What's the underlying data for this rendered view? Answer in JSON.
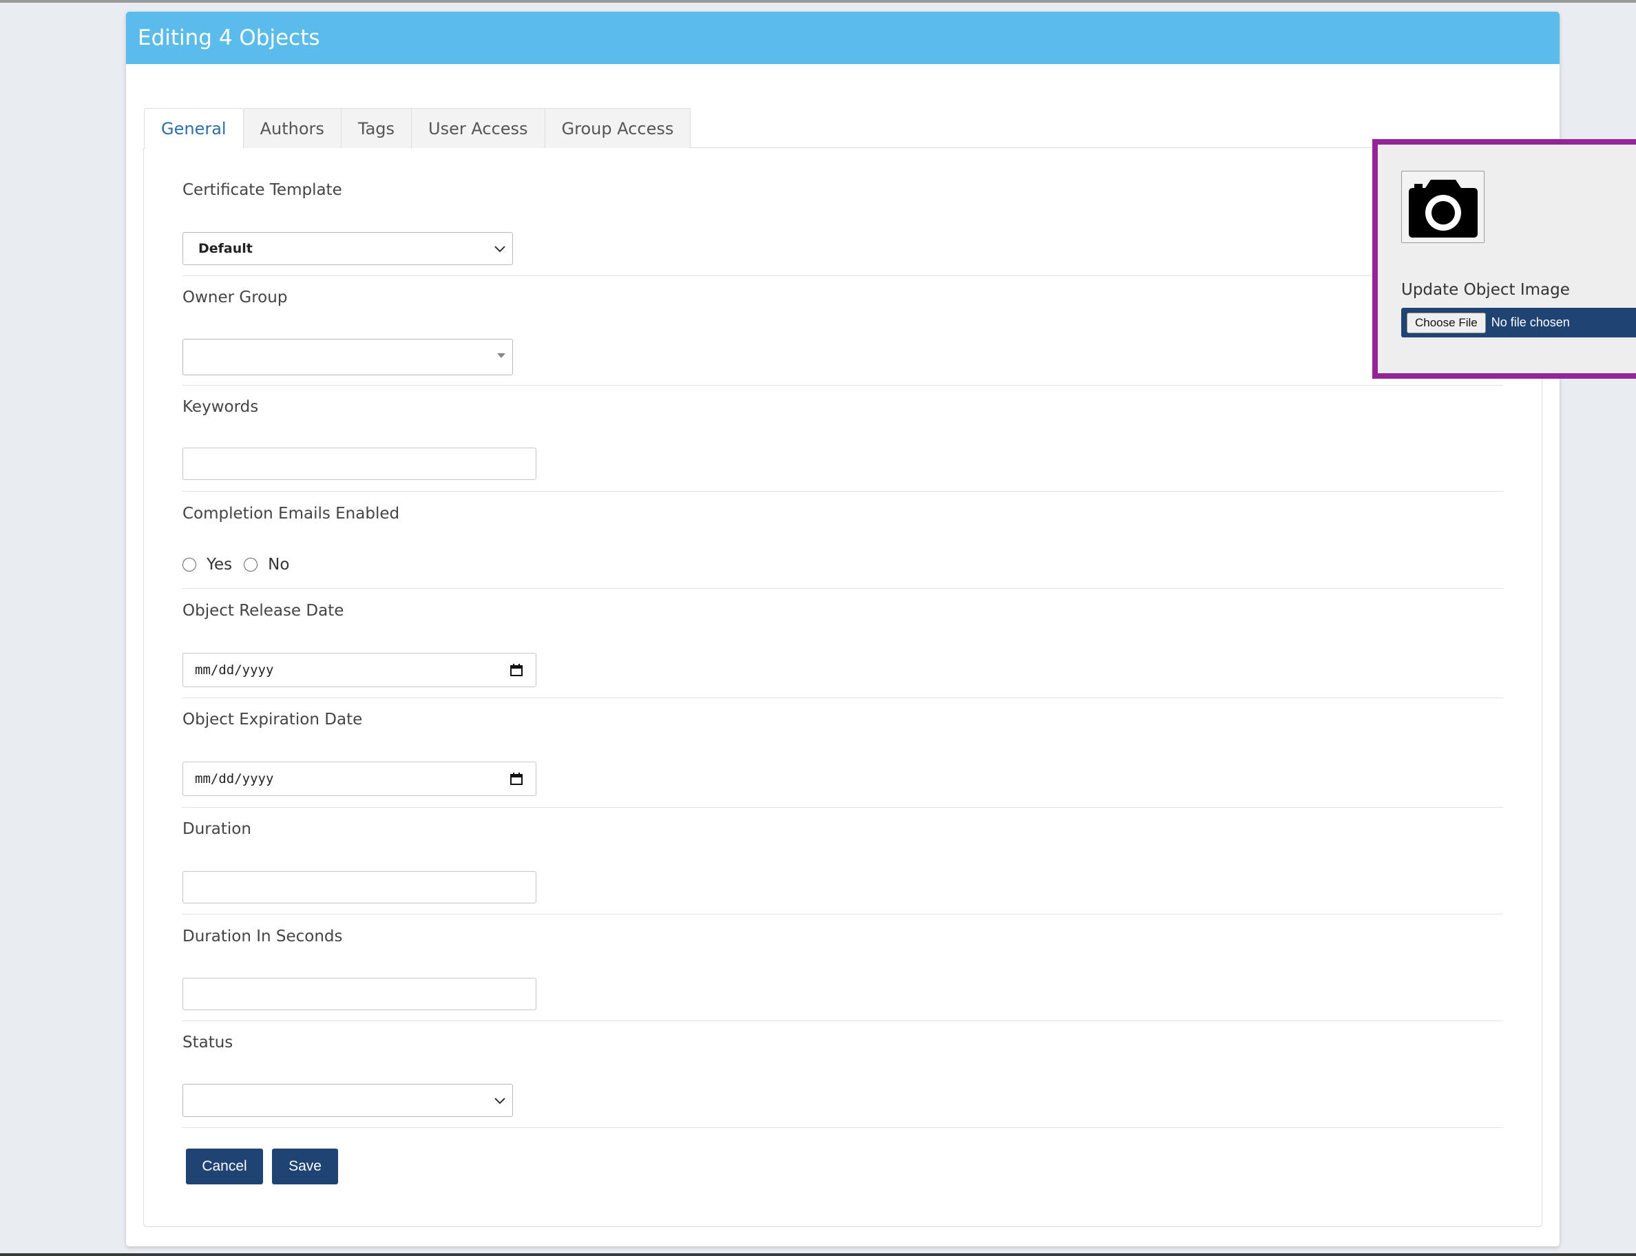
{
  "dialog": {
    "title": "Editing 4 Objects"
  },
  "tabs": [
    {
      "label": "General",
      "active": true
    },
    {
      "label": "Authors"
    },
    {
      "label": "Tags"
    },
    {
      "label": "User Access"
    },
    {
      "label": "Group Access"
    }
  ],
  "form": {
    "certificate_template": {
      "label": "Certificate Template",
      "value": "Default"
    },
    "owner_group": {
      "label": "Owner Group",
      "value": ""
    },
    "keywords": {
      "label": "Keywords",
      "value": ""
    },
    "completion_emails": {
      "label": "Completion Emails Enabled",
      "options": [
        "Yes",
        "No"
      ],
      "selected": null
    },
    "release_date": {
      "label": "Object Release Date",
      "placeholder": "mm/dd/yyyy"
    },
    "expiration_date": {
      "label": "Object Expiration Date",
      "placeholder": "mm/dd/yyyy"
    },
    "duration": {
      "label": "Duration",
      "value": ""
    },
    "duration_seconds": {
      "label": "Duration In Seconds",
      "value": ""
    },
    "status": {
      "label": "Status",
      "value": ""
    }
  },
  "actions": {
    "cancel_label": "Cancel",
    "save_label": "Save"
  },
  "image_panel": {
    "icon": "camera-icon",
    "label": "Update Object Image",
    "choose_file_label": "Choose File",
    "file_status": "No file chosen"
  },
  "colors": {
    "header": "#5bbbea",
    "primary_button": "#1f4373",
    "highlight_border": "#932599",
    "active_tab_text": "#2c6fa5"
  }
}
